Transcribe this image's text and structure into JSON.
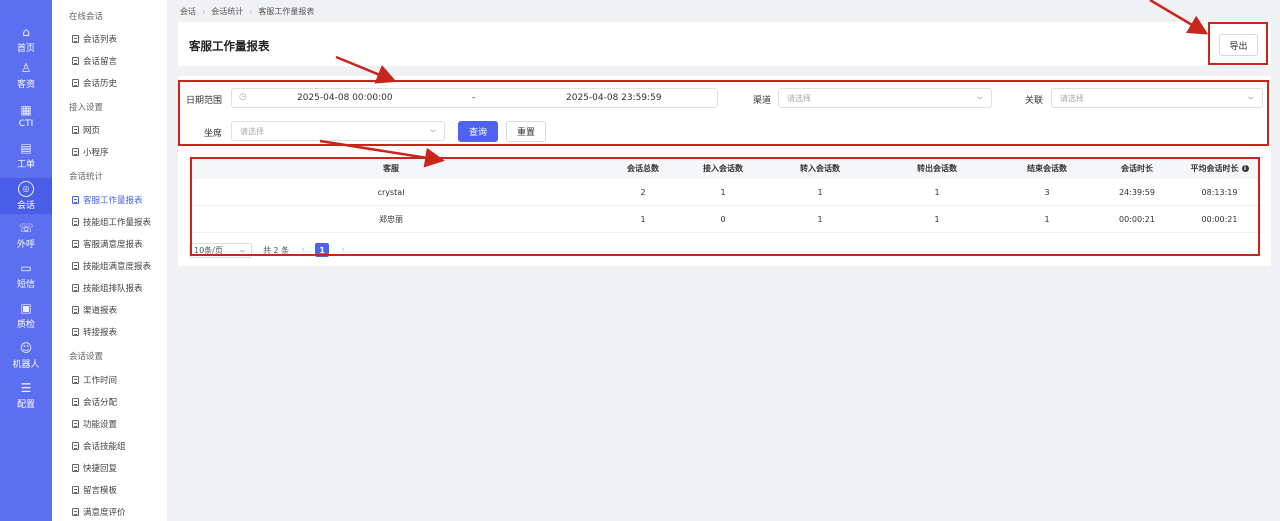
{
  "rail": {
    "items": [
      {
        "icon": "home-icon",
        "glyph": "⌂",
        "label": "首页"
      },
      {
        "icon": "customers-icon",
        "glyph": "♙",
        "label": "客资"
      },
      {
        "icon": "cti-icon",
        "glyph": "▦",
        "label": "CTI"
      },
      {
        "icon": "ticket-icon",
        "glyph": "▤",
        "label": "工单"
      },
      {
        "icon": "chat-icon",
        "glyph": "◎",
        "label": "会话"
      },
      {
        "icon": "outbound-call-icon",
        "glyph": "☏",
        "label": "外呼"
      },
      {
        "icon": "sms-icon",
        "glyph": "▭",
        "label": "短信"
      },
      {
        "icon": "quality-check-icon",
        "glyph": "▣",
        "label": "质检"
      },
      {
        "icon": "robot-icon",
        "glyph": "☺",
        "label": "机器人"
      },
      {
        "icon": "config-icon",
        "glyph": "☰",
        "label": "配置"
      }
    ]
  },
  "submenu": {
    "online_group": "在线会话",
    "online_items": [
      "会话列表",
      "会话留言",
      "会话历史"
    ],
    "access_group": "接入设置",
    "access_items": [
      "网页",
      "小程序"
    ],
    "stats_group": "会话统计",
    "stats_items": [
      "客服工作量报表",
      "技能组工作量报表",
      "客服满意度报表",
      "技能组满意度报表",
      "技能组排队报表",
      "渠道报表",
      "转接报表"
    ],
    "settings_group": "会话设置",
    "settings_items": [
      "工作时间",
      "会话分配",
      "功能设置",
      "会话技能组",
      "快捷回复",
      "留言模板",
      "满意度评价"
    ]
  },
  "breadcrumb": [
    "会话",
    "会话统计",
    "客服工作量报表"
  ],
  "header": {
    "title": "客服工作量报表",
    "export_label": "导出"
  },
  "filters": {
    "date_range_label": "日期范围",
    "date_start": "2025-04-08 00:00:00",
    "date_sep": "-",
    "date_end": "2025-04-08 23:59:59",
    "channel_label": "渠道",
    "channel_placeholder": "请选择",
    "relation_label": "关联",
    "relation_placeholder": "请选择",
    "agent_label": "坐席",
    "agent_placeholder": "请选择",
    "query_label": "查询",
    "reset_label": "重置"
  },
  "table": {
    "columns": [
      "客服",
      "会话总数",
      "接入会话数",
      "转入会话数",
      "转出会话数",
      "结束会话数",
      "会话时长",
      "平均会话时长"
    ],
    "rows": [
      [
        "crystal",
        "2",
        "1",
        "1",
        "1",
        "3",
        "24:39:59",
        "08:13:19"
      ],
      [
        "郑忠丽",
        "1",
        "0",
        "1",
        "1",
        "1",
        "00:00:21",
        "00:00:21"
      ]
    ]
  },
  "pagination": {
    "page_size": "10条/页",
    "total": "共 2 条",
    "prev": "‹",
    "current": "1",
    "next": "›"
  },
  "colors": {
    "primary": "#4e63f0",
    "rail": "#5b6ff0",
    "annotation": "#c8261c"
  }
}
